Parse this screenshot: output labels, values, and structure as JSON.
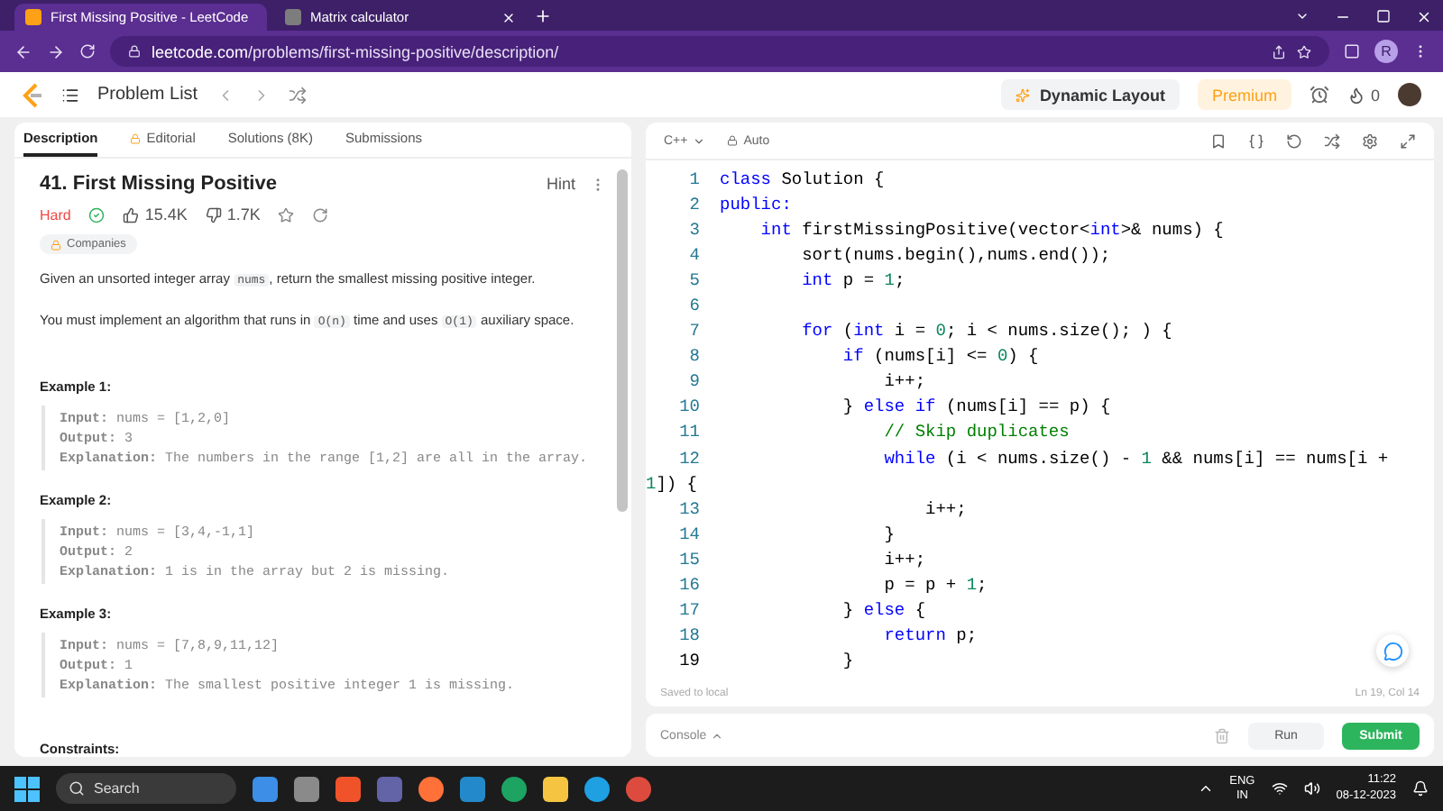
{
  "browser": {
    "tabs": [
      {
        "title": "First Missing Positive - LeetCode",
        "selected": true
      },
      {
        "title": "Matrix calculator",
        "selected": false
      }
    ],
    "url_host": "leetcode.com",
    "url_path": "/problems/first-missing-positive/description/",
    "profile": "R"
  },
  "nav": {
    "problem_list": "Problem List",
    "dynamic_layout": "Dynamic Layout",
    "premium": "Premium",
    "streak": "0"
  },
  "left_tabs": [
    {
      "label": "Description",
      "selected": true,
      "kind": "plain"
    },
    {
      "label": "Editorial",
      "selected": false,
      "kind": "locked"
    },
    {
      "label": "Solutions (8K)",
      "selected": false,
      "kind": "plain"
    },
    {
      "label": "Submissions",
      "selected": false,
      "kind": "plain"
    }
  ],
  "problem": {
    "title": "41. First Missing Positive",
    "hint": "Hint",
    "difficulty": "Hard",
    "likes": "15.4K",
    "dislikes": "1.7K",
    "companies": "Companies",
    "paragraphs": [
      [
        {
          "text": "Given an unsorted integer array ",
          "kind": "text"
        },
        {
          "text": "nums",
          "kind": "code"
        },
        {
          "text": ", return the smallest missing positive integer.",
          "kind": "text"
        }
      ],
      [
        {
          "text": "You must implement an algorithm that runs in ",
          "kind": "text"
        },
        {
          "text": "O(n)",
          "kind": "code"
        },
        {
          "text": " time and uses ",
          "kind": "text"
        },
        {
          "text": "O(1)",
          "kind": "code"
        },
        {
          "text": " auxiliary space.",
          "kind": "text"
        }
      ]
    ],
    "examples": [
      {
        "title": "Example 1:",
        "lines": [
          "**Input:** nums = [1,2,0]",
          "**Output:** 3",
          "**Explanation:** The numbers in the range [1,2] are all in the array."
        ]
      },
      {
        "title": "Example 2:",
        "lines": [
          "**Input:** nums = [3,4,-1,1]",
          "**Output:** 2",
          "**Explanation:** 1 is in the array but 2 is missing."
        ]
      },
      {
        "title": "Example 3:",
        "lines": [
          "**Input:** nums = [7,8,9,11,12]",
          "**Output:** 1",
          "**Explanation:** The smallest positive integer 1 is missing."
        ]
      }
    ],
    "constraints": "Constraints:"
  },
  "editor": {
    "language": "C++",
    "mode": "Auto",
    "status": "Saved to local",
    "cursor": "Ln 19, Col 14",
    "lines": [
      {
        "number": "1",
        "tokens": [
          {
            "text": "class",
            "kind": "kw"
          },
          {
            "text": " Solution {",
            "kind": "p"
          }
        ]
      },
      {
        "number": "2",
        "tokens": [
          {
            "text": "public:",
            "kind": "kw"
          }
        ]
      },
      {
        "number": "3",
        "tokens": [
          {
            "text": "    int",
            "kind": "kw"
          },
          {
            "text": " firstMissingPositive(vector<",
            "kind": "p"
          },
          {
            "text": "int",
            "kind": "kw"
          },
          {
            "text": ">& nums) {",
            "kind": "p"
          }
        ]
      },
      {
        "number": "4",
        "tokens": [
          {
            "text": "        sort(nums.begin(),nums.end());",
            "kind": "p"
          }
        ]
      },
      {
        "number": "5",
        "tokens": [
          {
            "text": "        int",
            "kind": "kw"
          },
          {
            "text": " p = ",
            "kind": "p"
          },
          {
            "text": "1",
            "kind": "num"
          },
          {
            "text": ";",
            "kind": "p"
          }
        ]
      },
      {
        "number": "6"
      },
      {
        "number": "7",
        "tokens": [
          {
            "text": "        for",
            "kind": "kw"
          },
          {
            "text": " (",
            "kind": "p"
          },
          {
            "text": "int",
            "kind": "kw"
          },
          {
            "text": " i = ",
            "kind": "p"
          },
          {
            "text": "0",
            "kind": "num"
          },
          {
            "text": "; i < nums.size(); ) {",
            "kind": "p"
          }
        ]
      },
      {
        "number": "8",
        "tokens": [
          {
            "text": "            if",
            "kind": "kw"
          },
          {
            "text": " (nums[i] <= ",
            "kind": "p"
          },
          {
            "text": "0",
            "kind": "num"
          },
          {
            "text": ") {",
            "kind": "p"
          }
        ]
      },
      {
        "number": "9",
        "tokens": [
          {
            "text": "                i++;",
            "kind": "p"
          }
        ]
      },
      {
        "number": "10",
        "tokens": [
          {
            "text": "            } ",
            "kind": "p"
          },
          {
            "text": "else if",
            "kind": "kw"
          },
          {
            "text": " (nums[i] == p) {",
            "kind": "p"
          }
        ]
      },
      {
        "number": "11",
        "tokens": [
          {
            "text": "                // Skip duplicates",
            "kind": "comment"
          }
        ]
      },
      {
        "number": "12",
        "tokens": [
          {
            "text": "                while",
            "kind": "kw"
          },
          {
            "text": " (i < nums.size() - ",
            "kind": "p"
          },
          {
            "text": "1",
            "kind": "num"
          },
          {
            "text": " && nums[i] == nums[i +",
            "kind": "p"
          }
        ],
        "continuation": [
          {
            "text": "1",
            "kind": "num"
          },
          {
            "text": "]) {",
            "kind": "p"
          }
        ]
      },
      {
        "number": "13",
        "tokens": [
          {
            "text": "                    i++;",
            "kind": "p"
          }
        ]
      },
      {
        "number": "14",
        "tokens": [
          {
            "text": "                }",
            "kind": "p"
          }
        ]
      },
      {
        "number": "15",
        "tokens": [
          {
            "text": "                i++;",
            "kind": "p"
          }
        ]
      },
      {
        "number": "16",
        "tokens": [
          {
            "text": "                p = p + ",
            "kind": "p"
          },
          {
            "text": "1",
            "kind": "num"
          },
          {
            "text": ";",
            "kind": "p"
          }
        ]
      },
      {
        "number": "17",
        "tokens": [
          {
            "text": "            } ",
            "kind": "p"
          },
          {
            "text": "else",
            "kind": "kw"
          },
          {
            "text": " {",
            "kind": "p"
          }
        ]
      },
      {
        "number": "18",
        "tokens": [
          {
            "text": "                return",
            "kind": "kw"
          },
          {
            "text": " p;",
            "kind": "p"
          }
        ]
      },
      {
        "number": "19",
        "tokens": [
          {
            "text": "            }",
            "kind": "p"
          }
        ]
      }
    ]
  },
  "console": {
    "label": "Console",
    "run": "Run",
    "submit": "Submit"
  },
  "taskbar": {
    "search": "Search",
    "language": "ENG",
    "region": "IN",
    "time": "11:22",
    "date": "08-12-2023"
  }
}
